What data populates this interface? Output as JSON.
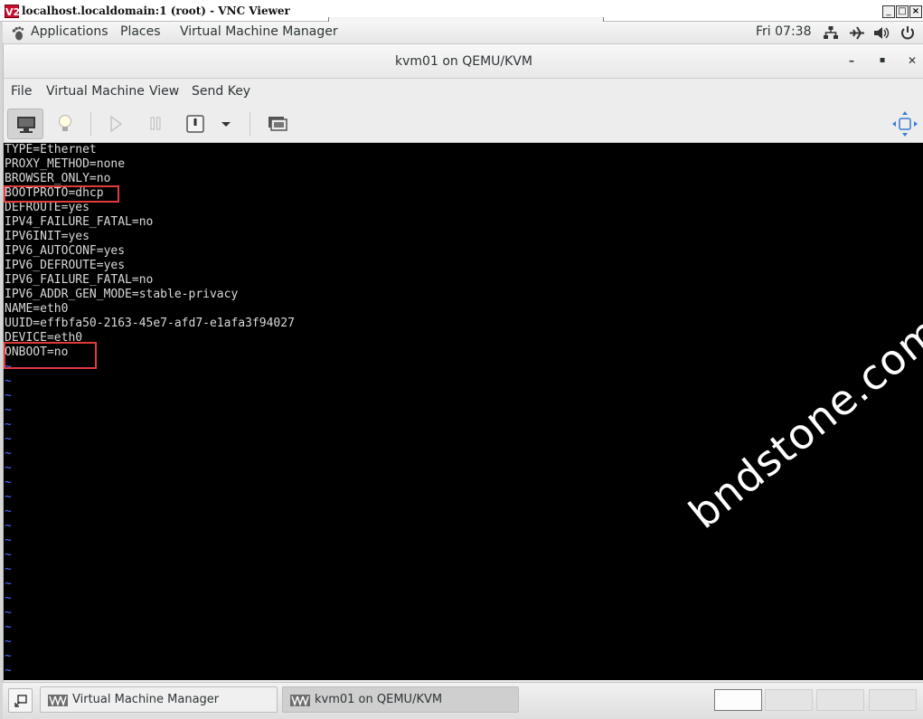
{
  "vnc": {
    "logo": "V2",
    "title": "localhost.localdomain:1 (root) - VNC Viewer",
    "controls": {
      "minimize": "_",
      "restore": "□",
      "close": "×"
    }
  },
  "top_panel": {
    "applications": "Applications",
    "places": "Places",
    "virt_manager": "Virtual Machine Manager",
    "clock": "Fri 07:38",
    "tray_icons": [
      "network-icon",
      "airplane-icon",
      "volume-icon",
      "power-icon"
    ]
  },
  "vm_window": {
    "title": "kvm01 on QEMU/KVM",
    "controls": {
      "minimize": "–",
      "maximize": "▪",
      "close": "✕"
    },
    "menu": [
      "File",
      "Virtual Machine",
      "View",
      "Send Key"
    ],
    "toolbar": [
      "console-icon",
      "details-bulb-icon",
      "run-icon",
      "pause-icon",
      "shutdown-icon",
      "shutdown-menu-chevron-icon",
      "snapshots-icon",
      "fullscreen-icon"
    ]
  },
  "console": {
    "lines": [
      "TYPE=Ethernet",
      "PROXY_METHOD=none",
      "BROWSER_ONLY=no",
      "BOOTPROTO=dhcp",
      "DEFROUTE=yes",
      "IPV4_FAILURE_FATAL=no",
      "IPV6INIT=yes",
      "IPV6_AUTOCONF=yes",
      "IPV6_DEFROUTE=yes",
      "IPV6_FAILURE_FATAL=no",
      "IPV6_ADDR_GEN_MODE=stable-privacy",
      "NAME=eth0",
      "UUID=effbfa50-2163-45e7-afd7-e1afa3f94027",
      "DEVICE=eth0",
      "ONBOOT=no"
    ],
    "tilde": "~",
    "tilde_color": "#4f6bff",
    "highlight_color": "#e23b3b",
    "highlighted_lines": [
      "BOOTPROTO=dhcp",
      "ONBOOT=no"
    ],
    "watermark": "bndstone.com"
  },
  "taskbar": {
    "tasks": [
      {
        "label": "Virtual Machine Manager",
        "active": false
      },
      {
        "label": "kvm01 on QEMU/KVM",
        "active": true
      }
    ],
    "workspaces": 4,
    "active_workspace": 1
  }
}
